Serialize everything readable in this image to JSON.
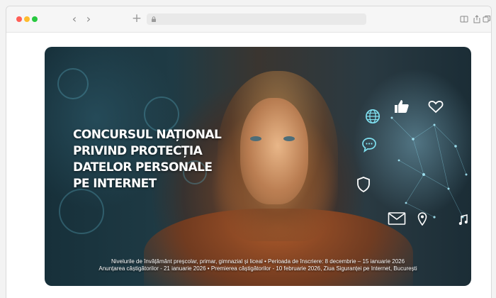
{
  "browser": {
    "controls": [
      "close",
      "minimize",
      "maximize"
    ],
    "nav": {
      "back_glyph": "‹",
      "forward_glyph": "›",
      "new_tab_glyph": "+"
    },
    "address_icon": "lock-icon",
    "toolbar_icons": [
      "reader-icon",
      "share-icon",
      "tabs-icon"
    ]
  },
  "hero": {
    "title_lines": [
      "CONCURSUL NAȚIONAL",
      "PRIVIND PROTECȚIA",
      "DATELOR PERSONALE",
      "PE INTERNET"
    ],
    "caption_line1": "Nivelurile de învățământ preșcolar,  primar, gimnazial și liceal • Perioada de înscriere: 8 decembrie – 15 ianuarie 2026",
    "caption_line2": "Anunțarea câștigătorilor - 21 ianuarie 2026 • Premierea câștigătorilor - 10 februarie 2026, Ziua Siguranței pe Internet,  București",
    "floating_icons": [
      "globe-icon",
      "thumbs-up-icon",
      "heart-icon",
      "chat-icon",
      "shield-icon",
      "mail-icon",
      "location-pin-icon",
      "music-note-icon"
    ],
    "colors": {
      "icon_cyan": "#7fe0f0",
      "icon_white": "#ffffff",
      "title": "#ffffff"
    }
  }
}
